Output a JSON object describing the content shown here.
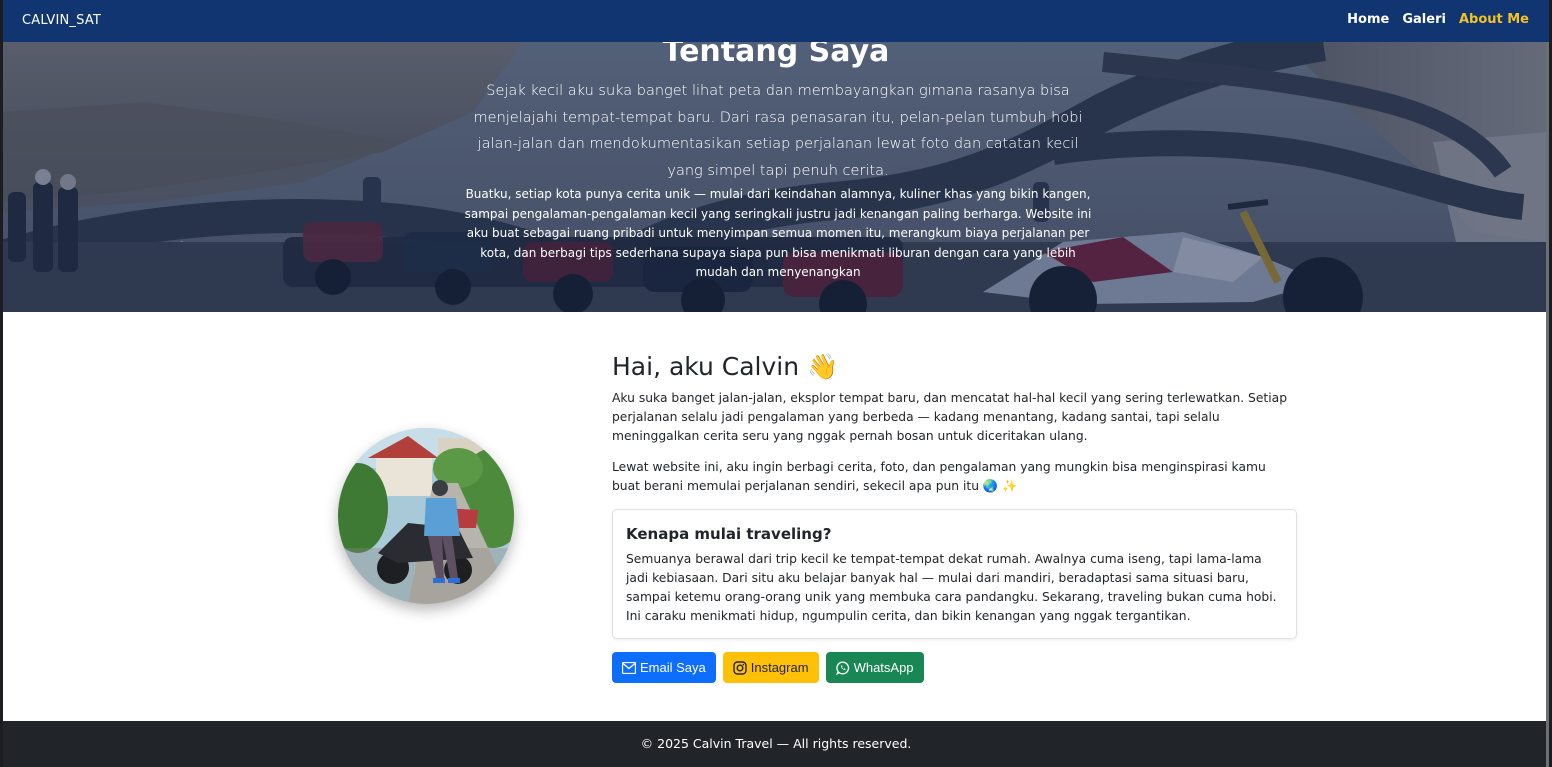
{
  "navbar": {
    "brand": "CALVIN_SAT",
    "links": [
      {
        "label": "Home",
        "active": false
      },
      {
        "label": "Galeri",
        "active": false
      },
      {
        "label": "About Me",
        "active": true
      }
    ]
  },
  "hero": {
    "title": "Tentang Saya",
    "lead": "Sejak kecil aku suka banget lihat peta dan membayangkan gimana rasanya bisa menjelajahi tempat-tempat baru. Dari rasa penasaran itu, pelan-pelan tumbuh hobi jalan-jalan dan mendokumentasikan setiap perjalanan lewat foto dan catatan kecil yang simpel tapi penuh cerita.",
    "sub": "Buatku, setiap kota punya cerita unik — mulai dari keindahan alamnya, kuliner khas yang bikin kangen, sampai pengalaman-pengalaman kecil yang seringkali justru jadi kenangan paling berharga. Website ini aku buat sebagai ruang pribadi untuk menyimpan semua momen itu, merangkum biaya perjalanan per kota, dan berbagi tips sederhana supaya siapa pun bisa menikmati liburan dengan cara yang lebih mudah dan menyenangkan"
  },
  "about": {
    "greeting": "Hai, aku Calvin",
    "greeting_emoji": "👋",
    "para1": "Aku suka banget jalan-jalan, eksplor tempat baru, dan mencatat hal-hal kecil yang sering terlewatkan. Setiap perjalanan selalu jadi pengalaman yang berbeda — kadang menantang, kadang santai, tapi selalu meninggalkan cerita seru yang nggak pernah bosan untuk diceritakan ulang.",
    "para2": "Lewat website ini, aku ingin berbagi cerita, foto, dan pengalaman yang mungkin bisa menginspirasi kamu buat berani memulai perjalanan sendiri, sekecil apa pun itu 🌏 ✨"
  },
  "card": {
    "title": "Kenapa mulai traveling?",
    "text": "Semuanya berawal dari trip kecil ke tempat-tempat dekat rumah. Awalnya cuma iseng, tapi lama-lama jadi kebiasaan. Dari situ aku belajar banyak hal — mulai dari mandiri, beradaptasi sama situasi baru, sampai ketemu orang-orang unik yang membuka cara pandangku. Sekarang, traveling bukan cuma hobi. Ini caraku menikmati hidup, ngumpulin cerita, dan bikin kenangan yang nggak tergantikan."
  },
  "buttons": {
    "email": "Email Saya",
    "instagram": "Instagram",
    "whatsapp": "WhatsApp"
  },
  "footer": {
    "text": "© 2025 Calvin Travel — All rights reserved."
  },
  "colors": {
    "navbar": "#103570",
    "active_link": "#f3c226",
    "email_button": "#0d6efd",
    "instagram_button": "#ffc107",
    "whatsapp_button": "#198754",
    "footer": "#212529"
  },
  "icons": {
    "email": "envelope-icon",
    "instagram": "instagram-icon",
    "whatsapp": "whatsapp-icon",
    "wave": "waving-hand-emoji"
  }
}
